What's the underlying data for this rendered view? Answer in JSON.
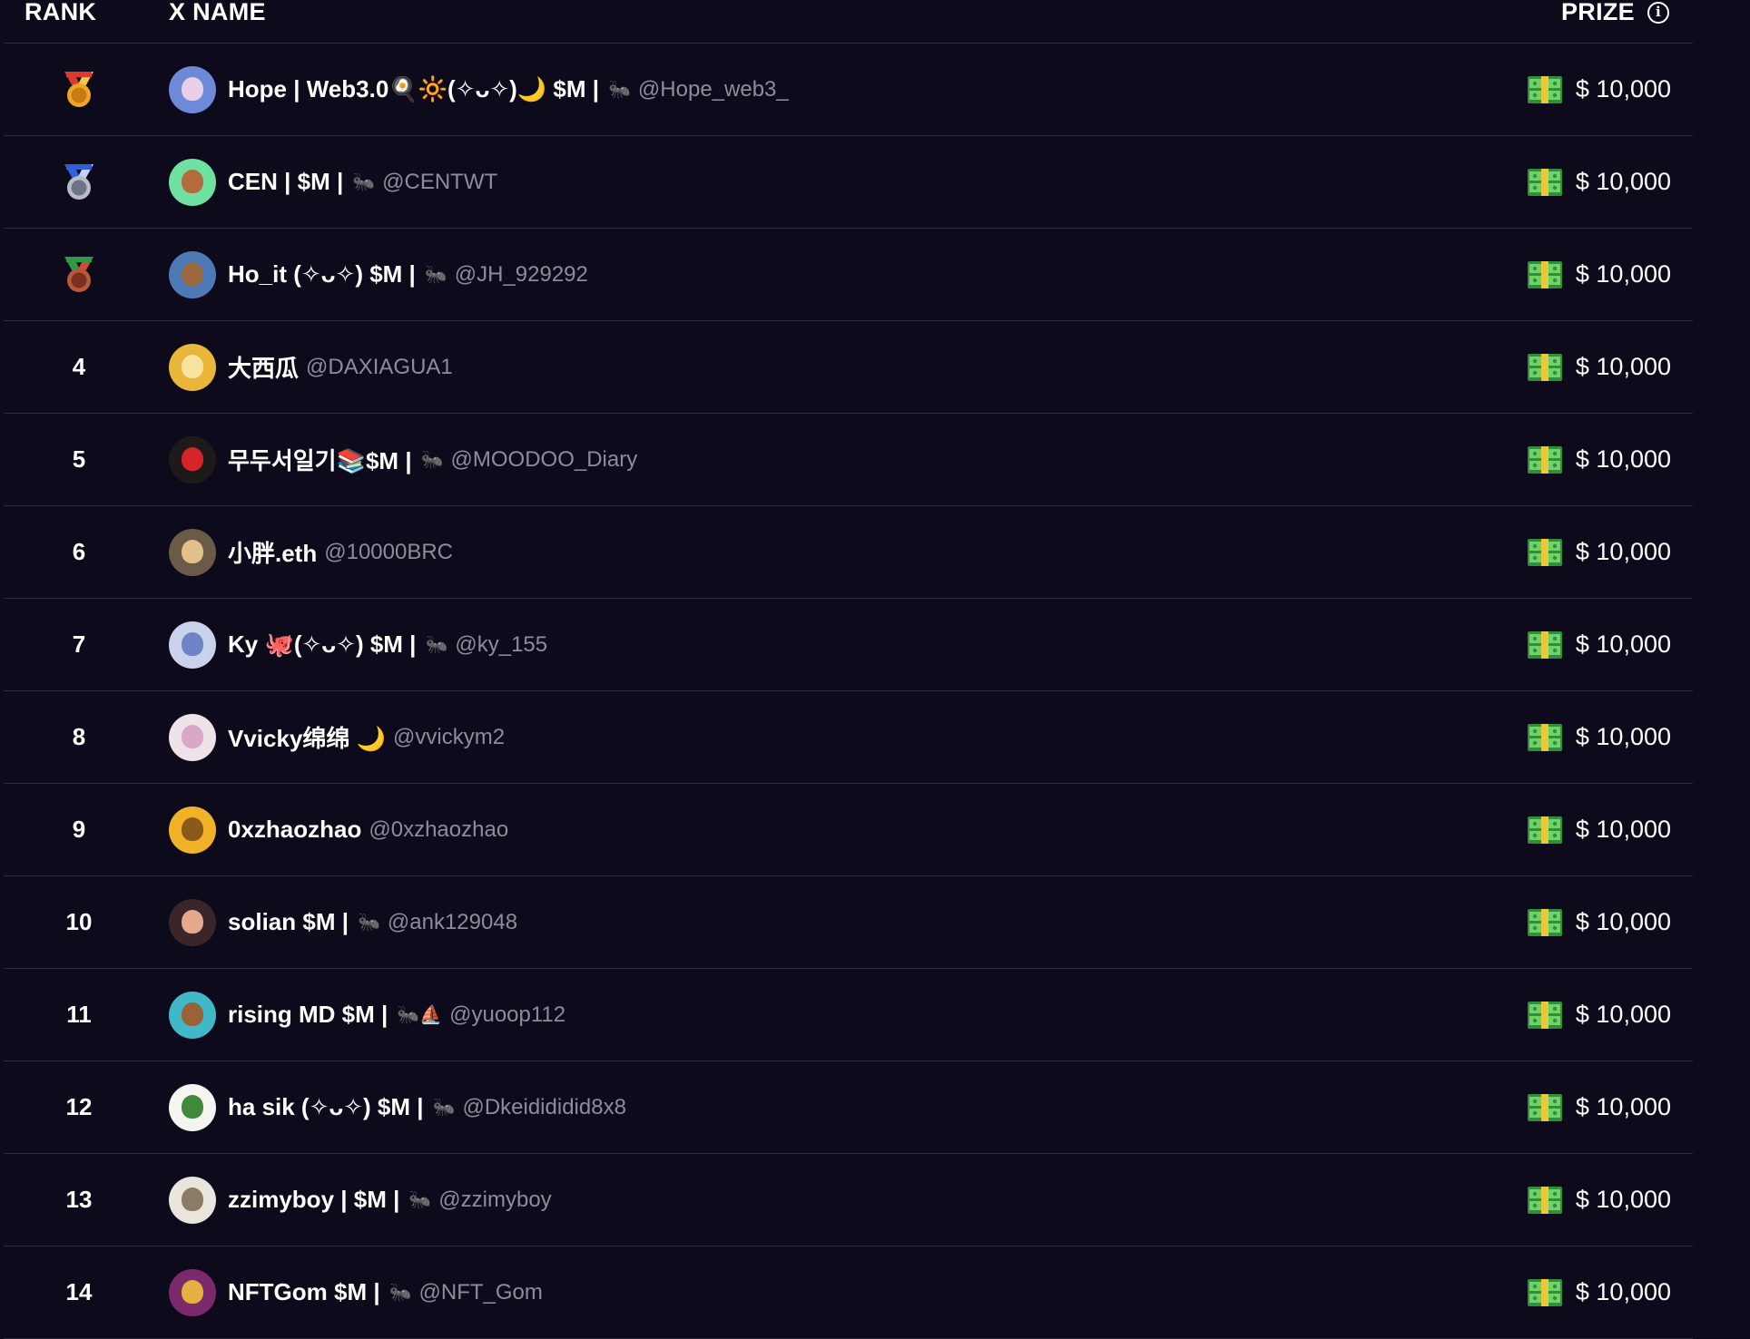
{
  "header": {
    "rank": "RANK",
    "name": "X NAME",
    "prize": "PRIZE",
    "info_icon": "i"
  },
  "colors": {
    "background": "#0d0b1b",
    "divider": "#2c2b3d",
    "handle": "#8e8c98",
    "gold": "#f0a626",
    "silver": "#b7bcc8",
    "bronze": "#b65a3c"
  },
  "rows": [
    {
      "rank": "",
      "medal": "gold-medal-icon",
      "name": "Hope | Web3.0🍳🔆(✧ᴗ✧)🌙 $M |",
      "ant": true,
      "handle": "@Hope_web3_",
      "prize": "$ 10,000",
      "avatar_bg": "#6c8ad8",
      "avatar_fg": "#e8d0e8"
    },
    {
      "rank": "",
      "medal": "silver-medal-icon",
      "name": "CEN | $M |",
      "ant": true,
      "handle": "@CENTWT",
      "prize": "$ 10,000",
      "avatar_bg": "#6fe0a0",
      "avatar_fg": "#b46a3c"
    },
    {
      "rank": "",
      "medal": "bronze-medal-icon",
      "name": "Ho_it (✧ᴗ✧) $M |",
      "ant": true,
      "handle": "@JH_929292",
      "prize": "$ 10,000",
      "avatar_bg": "#4d7ab5",
      "avatar_fg": "#9c6a40"
    },
    {
      "rank": "4",
      "name": "大西瓜",
      "ant": false,
      "handle": "@DAXIAGUA1",
      "prize": "$ 10,000",
      "avatar_bg": "#e9b63a",
      "avatar_fg": "#f7e2a0"
    },
    {
      "rank": "5",
      "name": "무두서일기📚$M |",
      "ant": true,
      "handle": "@MOODOO_Diary",
      "prize": "$ 10,000",
      "avatar_bg": "#1e1a1a",
      "avatar_fg": "#d6252a"
    },
    {
      "rank": "6",
      "name": "小胖.eth",
      "ant": false,
      "handle": "@10000BRC",
      "prize": "$ 10,000",
      "avatar_bg": "#6b5a48",
      "avatar_fg": "#e2c08a"
    },
    {
      "rank": "7",
      "name": "Ky 🐙(✧ᴗ✧) $M |",
      "ant": true,
      "handle": "@ky_155",
      "prize": "$ 10,000",
      "avatar_bg": "#c9d2ea",
      "avatar_fg": "#6f84c6"
    },
    {
      "rank": "8",
      "name": "Vvicky绵绵 🌙",
      "ant": false,
      "handle": "@vvickym2",
      "prize": "$ 10,000",
      "avatar_bg": "#efe3ea",
      "avatar_fg": "#d9a8c8"
    },
    {
      "rank": "9",
      "name": "0xzhaozhao",
      "ant": false,
      "handle": "@0xzhaozhao",
      "prize": "$ 10,000",
      "avatar_bg": "#f1b22a",
      "avatar_fg": "#8a5a1c"
    },
    {
      "rank": "10",
      "name": "solian $M |",
      "ant": true,
      "handle": "@ank129048",
      "prize": "$ 10,000",
      "avatar_bg": "#3a2628",
      "avatar_fg": "#e3aa90"
    },
    {
      "rank": "11",
      "name": "rising MD $M |",
      "ant": true,
      "ant_extra": "⛵",
      "handle": "@yuoop112",
      "prize": "$ 10,000",
      "avatar_bg": "#3fb8c8",
      "avatar_fg": "#9a6236"
    },
    {
      "rank": "12",
      "name": "ha sik (✧ᴗ✧) $M |",
      "ant": true,
      "handle": "@Dkeidididid8x8",
      "prize": "$ 10,000",
      "avatar_bg": "#f4f4f0",
      "avatar_fg": "#3f8a3a"
    },
    {
      "rank": "13",
      "name": "zzimyboy | $M |",
      "ant": true,
      "handle": "@zzimyboy",
      "prize": "$ 10,000",
      "avatar_bg": "#e9e4dc",
      "avatar_fg": "#8b7b66"
    },
    {
      "rank": "14",
      "name": "NFTGom $M |",
      "ant": true,
      "handle": "@NFT_Gom",
      "prize": "$ 10,000",
      "avatar_bg": "#7a2a6a",
      "avatar_fg": "#e4b040"
    }
  ]
}
